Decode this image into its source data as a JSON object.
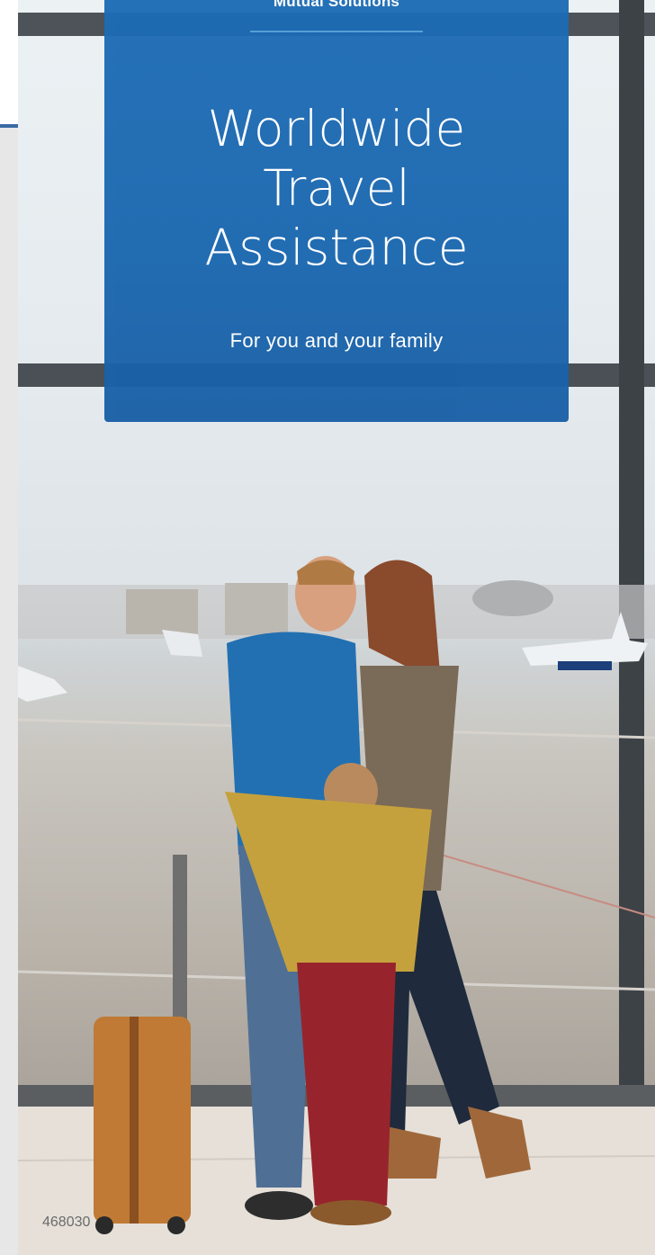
{
  "cover": {
    "brand": "Mutual Solutions",
    "title_lines": [
      "Worldwide",
      "Travel",
      "Assistance"
    ],
    "subtitle": "For you and your family",
    "doc_code": "468030"
  },
  "colors": {
    "panel_blue": "#1b67b0",
    "brand_rule": "#56a3de",
    "left_accent": "#3a6aa4"
  },
  "photo": {
    "description_icon": "family-airport-photo"
  }
}
